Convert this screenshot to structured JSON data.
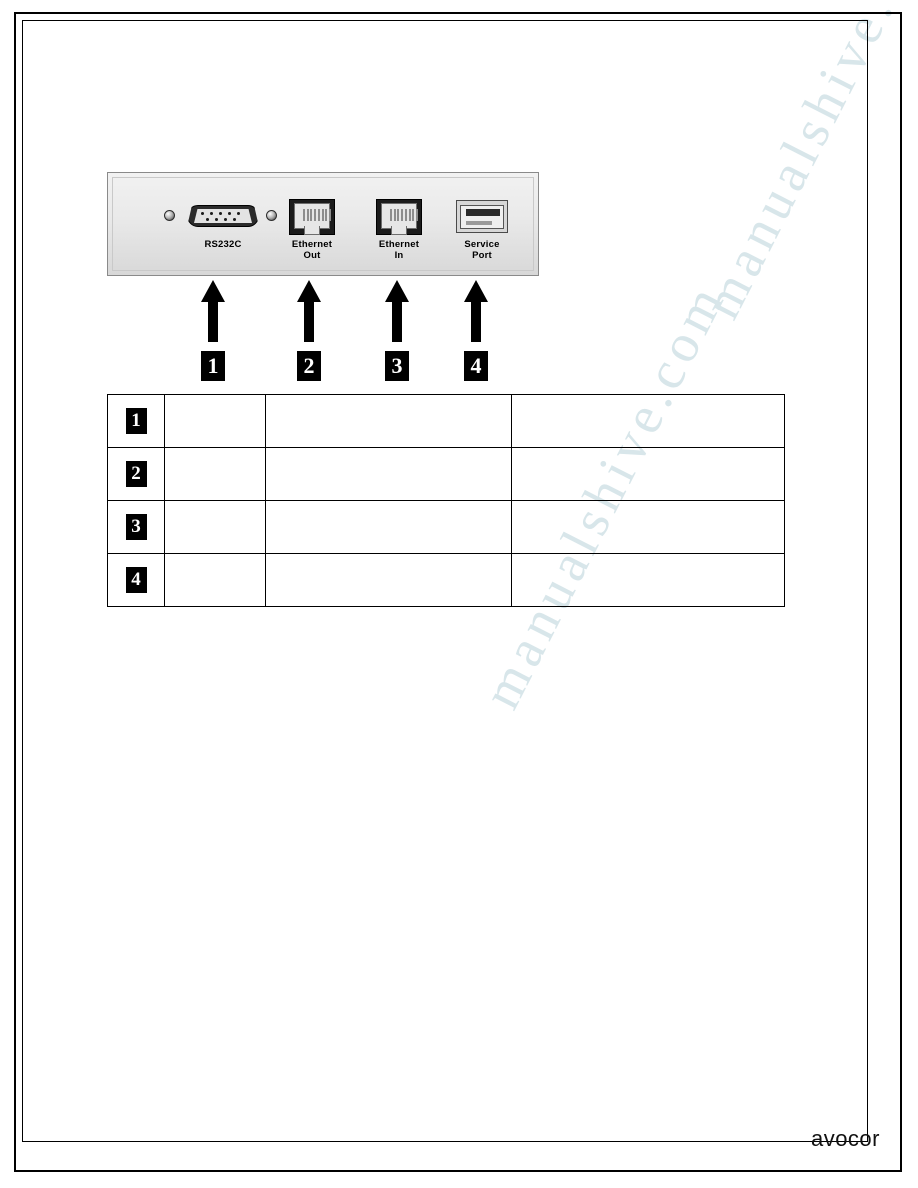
{
  "document": {
    "logo_text": "avocor",
    "watermark_text": "manualshive.com"
  },
  "panel": {
    "ports": [
      {
        "id": "rs232c",
        "label": "RS232C",
        "label2": ""
      },
      {
        "id": "ethernet-out",
        "label": "Ethernet",
        "label2": "Out"
      },
      {
        "id": "ethernet-in",
        "label": "Ethernet",
        "label2": "In"
      },
      {
        "id": "service-port",
        "label": "Service",
        "label2": "Port"
      }
    ]
  },
  "callouts": [
    {
      "number": "1"
    },
    {
      "number": "2"
    },
    {
      "number": "3"
    },
    {
      "number": "4"
    }
  ],
  "table": {
    "rows": [
      {
        "number": "1",
        "name": "",
        "description": "",
        "extra": ""
      },
      {
        "number": "2",
        "name": "",
        "description": "",
        "extra": ""
      },
      {
        "number": "3",
        "name": "",
        "description": "",
        "extra": ""
      },
      {
        "number": "4",
        "name": "",
        "description": "",
        "extra": ""
      }
    ]
  }
}
